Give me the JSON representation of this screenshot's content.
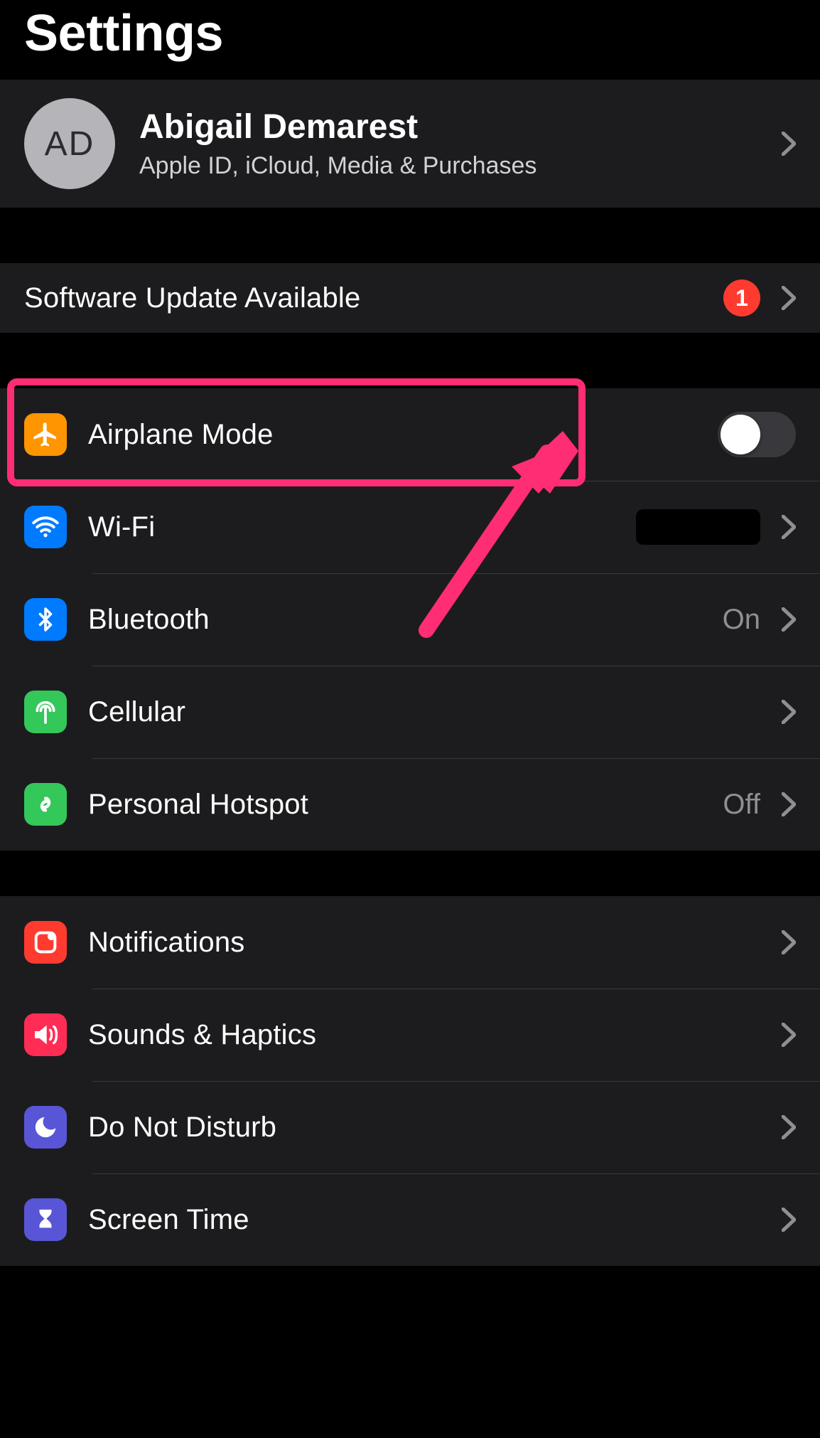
{
  "title": "Settings",
  "profile": {
    "initials": "AD",
    "name": "Abigail Demarest",
    "subtitle": "Apple ID, iCloud, Media & Purchases"
  },
  "software_update": {
    "label": "Software Update Available",
    "badge": "1"
  },
  "connectivity": {
    "airplane": {
      "label": "Airplane Mode",
      "on": false,
      "color": "#ff9500"
    },
    "wifi": {
      "label": "Wi-Fi",
      "value_redacted": true,
      "color": "#007aff"
    },
    "bluetooth": {
      "label": "Bluetooth",
      "value": "On",
      "color": "#007aff"
    },
    "cellular": {
      "label": "Cellular",
      "color": "#34c759"
    },
    "hotspot": {
      "label": "Personal Hotspot",
      "value": "Off",
      "color": "#34c759"
    }
  },
  "system": {
    "notifications": {
      "label": "Notifications",
      "color": "#ff3b30"
    },
    "sounds": {
      "label": "Sounds & Haptics",
      "color": "#ff2d55"
    },
    "dnd": {
      "label": "Do Not Disturb",
      "color": "#5856d6"
    },
    "screentime": {
      "label": "Screen Time",
      "color": "#5856d6"
    }
  },
  "annotation": {
    "highlight_target": "airplane-mode-row"
  }
}
